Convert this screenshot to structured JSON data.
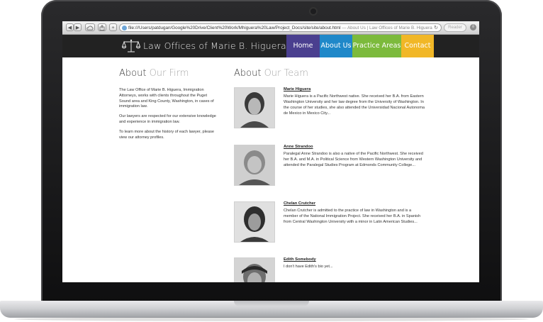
{
  "browser": {
    "url": "file:///Users/patdugan/Google%20Drive/Client%20Work/Mhiguera%20Law/Project_Docs/site/site/about.html",
    "separator": " — ",
    "page_title": "About Us | Law Offices of Marie B. Higuera",
    "reader_label": "Reader",
    "reload_glyph": "↻",
    "back_glyph": "◀",
    "forward_glyph": "▶",
    "add_glyph": "+",
    "download_glyph": "⇩"
  },
  "site": {
    "title": "Law Offices of Marie B. Higuera",
    "nav": [
      {
        "label": "Home",
        "color": "#4a3f8f"
      },
      {
        "label": "About Us",
        "color": "#1f88c9"
      },
      {
        "label": "Practice Areas",
        "color": "#7cba3c"
      },
      {
        "label": "Contact",
        "color": "#f1b727"
      }
    ]
  },
  "firm": {
    "heading_dark": "About",
    "heading_light": "Our Firm",
    "paragraphs": [
      "The Law Office of Marie B. Higuera, Immigration Attorneys, works with clients throughout the Puget Sound area and King County, Washington, in cases of immigration law.",
      "Our lawyers are respected for our extensive knowledge and experience in immigration law.",
      "To learn more about the history of each lawyer, please view our attorney profiles."
    ]
  },
  "team": {
    "heading_dark": "About",
    "heading_light": "Our Team",
    "members": [
      {
        "name": "Marie Higuera",
        "bio": "Marie Higuera is a Pacific Northwest native. She received her B.A. from Eastern Washington University and her law degree from the University of Washington. In the course of her studies, she also attended the Universidad Nacional Autonoma de Mexico in Mexico City..."
      },
      {
        "name": "Anne Strandoo",
        "bio": "Paralegal Anne Strandoo is also a native of the Pacific Northwest. She received her B.A. and M.A. in Political Science from Western Washington University and attended the Paralegal Studies Program at Edmonds Community College..."
      },
      {
        "name": "Chelan Crutcher",
        "bio": "Chelan Crutcher is admitted to the practice of law in Washington and is a member of the National Immigration Project. She received her B.A. in Spanish from Central Washington University with a minor in Latin American Studies..."
      },
      {
        "name": "Edith Somebody",
        "bio": "I don't have Edith's bio yet..."
      }
    ]
  }
}
